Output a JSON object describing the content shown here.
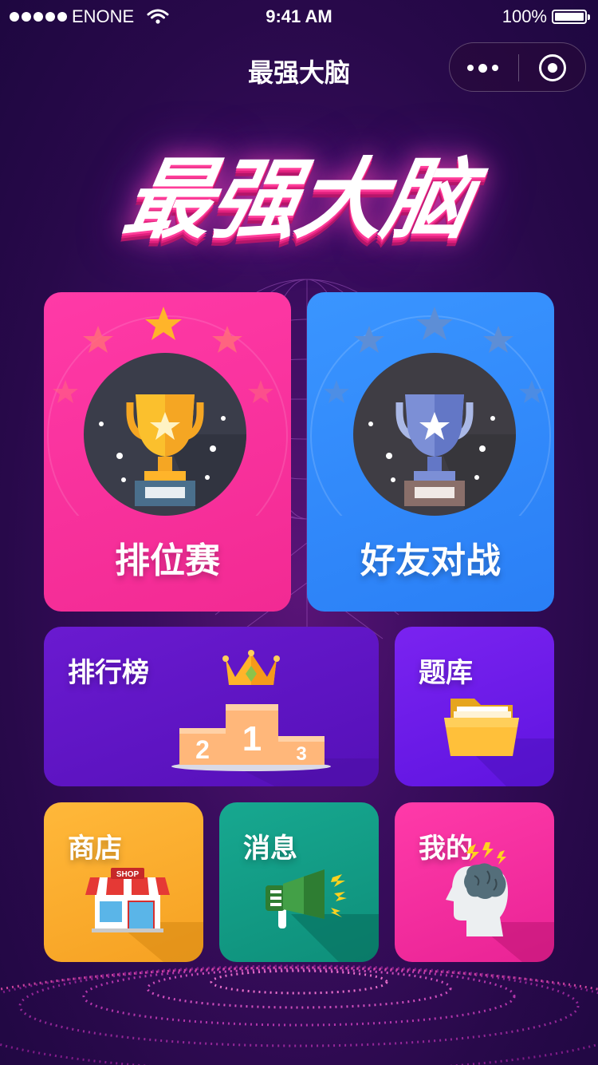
{
  "status_bar": {
    "carrier": "ENONE",
    "time": "9:41 AM",
    "battery": "100%"
  },
  "nav": {
    "title": "最强大脑"
  },
  "logo": {
    "text": "最强大脑"
  },
  "cards": {
    "ranked": {
      "label": "排位赛",
      "icon": "gold-trophy-icon"
    },
    "friend_battle": {
      "label": "好友对战",
      "icon": "silver-trophy-icon"
    },
    "leaderboard": {
      "label": "排行榜",
      "icon": "podium-icon"
    },
    "question_bank": {
      "label": "题库",
      "icon": "folder-icon"
    },
    "shop": {
      "label": "商店",
      "icon": "shop-icon",
      "sign": "SHOP"
    },
    "messages": {
      "label": "消息",
      "icon": "megaphone-icon"
    },
    "mine": {
      "label": "我的",
      "icon": "brain-head-icon"
    }
  },
  "podium": {
    "first": "1",
    "second": "2",
    "third": "3"
  },
  "colors": {
    "ranked": "#f22a93",
    "friend_battle": "#2a7ff6",
    "leaderboard": "#5510b8",
    "question_bank": "#5f14e0",
    "shop": "#f6a122",
    "messages": "#0e8f7a",
    "mine": "#e92395"
  }
}
